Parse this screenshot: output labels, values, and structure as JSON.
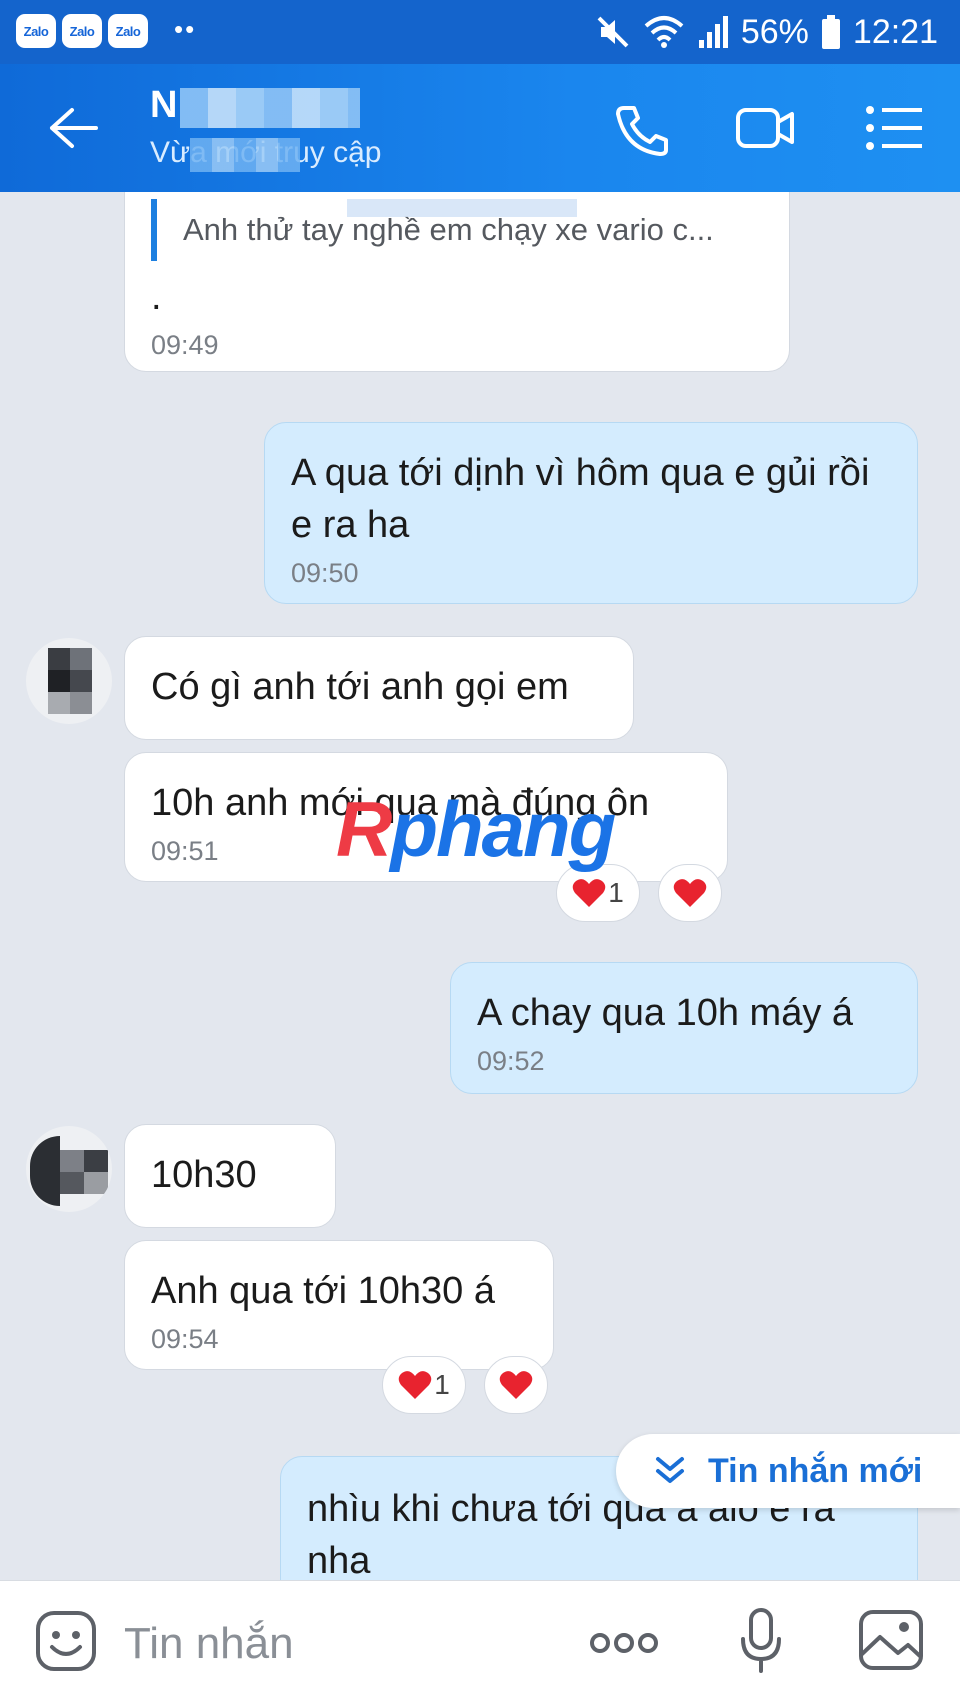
{
  "status_bar": {
    "app_badges": [
      "Zalo",
      "Zalo",
      "Zalo"
    ],
    "more_indicator": "••",
    "battery": "56%",
    "time": "12:21"
  },
  "header": {
    "name": "N",
    "status": "Vừa mới truy cập",
    "icons": [
      "back-arrow-icon",
      "phone-icon",
      "video-call-icon",
      "menu-icon"
    ]
  },
  "messages": [
    {
      "side": "received",
      "quote": "Anh thử tay nghề em chạy xe vario c...",
      "text": ".",
      "time": "09:49"
    },
    {
      "side": "sent",
      "text": "A qua tới dịnh vì hôm qua  e gủi rồi  e ra ha",
      "time": "09:50"
    },
    {
      "side": "received",
      "text": "Có gì anh tới anh gọi em"
    },
    {
      "side": "received",
      "text": "10h anh mới qua mà đúng ôn",
      "time": "09:51",
      "reaction_count": "1"
    },
    {
      "side": "sent",
      "text": "A chay qua 10h máy á",
      "time": "09:52"
    },
    {
      "side": "received",
      "text": "10h30"
    },
    {
      "side": "received",
      "text": "Anh qua tới 10h30 á",
      "time": "09:54",
      "reaction_count": "1"
    },
    {
      "side": "sent",
      "text": "nhìu khi chưa tới qua a alo e ra nha"
    }
  ],
  "watermark": {
    "part_a": "R",
    "part_b": "phang"
  },
  "new_message_pill": "Tin nhắn mới",
  "composer": {
    "placeholder": "Tin nhắn",
    "more": "ooo"
  },
  "colors": {
    "header": "#1a86ee",
    "sent_bubble": "#d4ecfe",
    "received_bubble": "#ffffff",
    "heart": "#e8232f"
  }
}
